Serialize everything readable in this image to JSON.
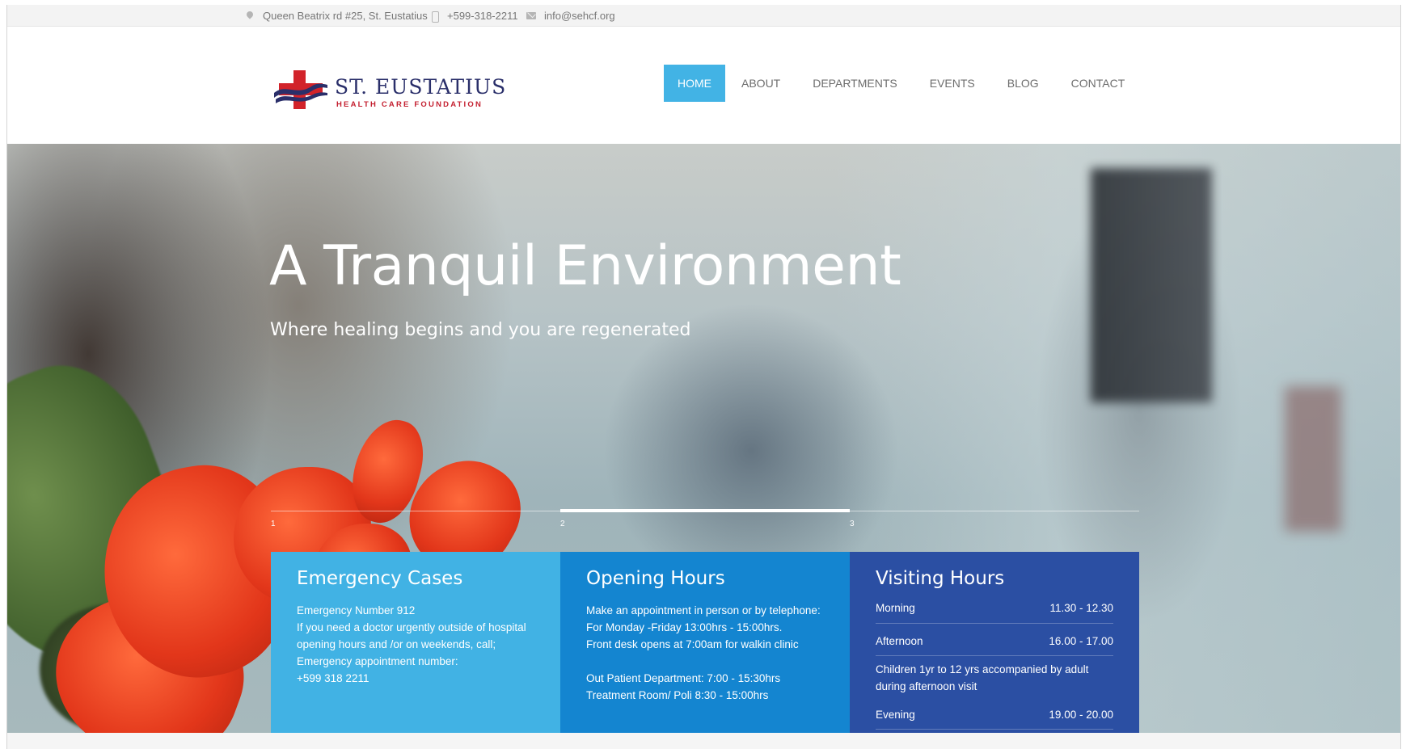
{
  "topbar": {
    "address": "Queen Beatrix rd #25, St. Eustatius",
    "phone": "+599-318-2211",
    "email": "info@sehcf.org"
  },
  "logo": {
    "line1": "ST. EUSTATIUS",
    "line2": "HEALTH CARE FOUNDATION"
  },
  "nav": {
    "items": [
      "HOME",
      "ABOUT",
      "DEPARTMENTS",
      "EVENTS",
      "BLOG",
      "CONTACT"
    ],
    "active": "HOME"
  },
  "hero": {
    "title": "A Tranquil Environment",
    "subtitle": "Where healing begins and you are regenerated"
  },
  "slider": {
    "numbers": [
      "1",
      "2",
      "3"
    ]
  },
  "boxes": {
    "emergency": {
      "title": "Emergency Cases",
      "lines": [
        "Emergency Number 912",
        "If you need a doctor urgently outside of hospital opening hours and /or on weekends, call;",
        "Emergency appointment number:",
        "+599 318 2211"
      ]
    },
    "opening": {
      "title": "Opening Hours",
      "lines": [
        "Make an appointment in person or by telephone: For Monday -Friday 13:00hrs - 15:00hrs.",
        "Front desk opens at 7:00am for walkin clinic",
        "",
        "Out Patient Department: 7:00 - 15:30hrs",
        "Treatment Room/ Poli 8:30 - 15:00hrs"
      ]
    },
    "visiting": {
      "title": "Visiting Hours",
      "morning_label": "Morning",
      "morning_time": "11.30 - 12.30",
      "afternoon_label": "Afternoon",
      "afternoon_time": "16.00 - 17.00",
      "note": "Children 1yr to 12 yrs accompanied by adult during afternoon visit",
      "evening_label": "Evening",
      "evening_time": "19.00 - 20.00"
    }
  },
  "colors": {
    "nav_active": "#42b3e5",
    "box_emergency": "#41b2e4",
    "box_opening": "#1485d0",
    "box_visiting": "#2b4fa3",
    "logo_navy": "#2a2f6a",
    "logo_red": "#c42030"
  },
  "icons": {
    "address": "map-pin-icon",
    "phone": "phone-icon",
    "email": "mail-icon"
  }
}
